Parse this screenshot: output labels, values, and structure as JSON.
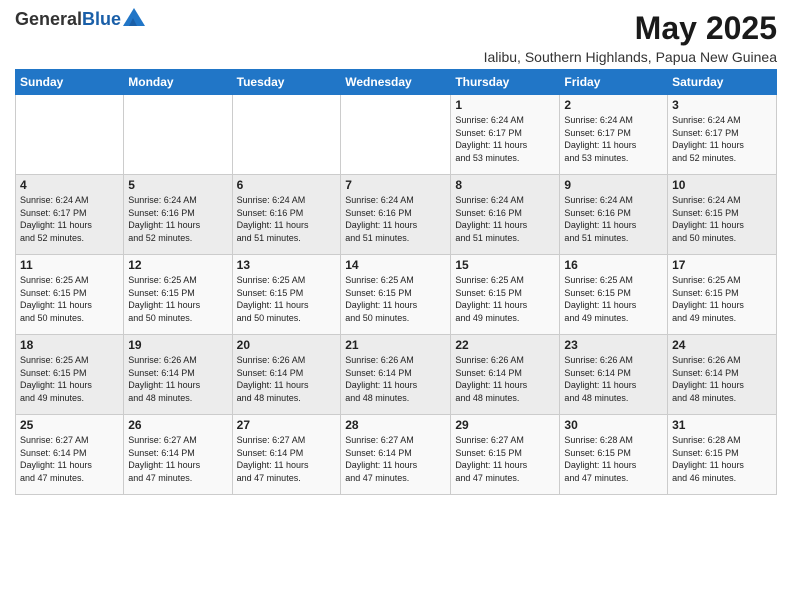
{
  "header": {
    "logo_general": "General",
    "logo_blue": "Blue",
    "month_title": "May 2025",
    "subtitle": "Ialibu, Southern Highlands, Papua New Guinea"
  },
  "days_of_week": [
    "Sunday",
    "Monday",
    "Tuesday",
    "Wednesday",
    "Thursday",
    "Friday",
    "Saturday"
  ],
  "weeks": [
    [
      {
        "day": "",
        "info": ""
      },
      {
        "day": "",
        "info": ""
      },
      {
        "day": "",
        "info": ""
      },
      {
        "day": "",
        "info": ""
      },
      {
        "day": "1",
        "info": "Sunrise: 6:24 AM\nSunset: 6:17 PM\nDaylight: 11 hours\nand 53 minutes."
      },
      {
        "day": "2",
        "info": "Sunrise: 6:24 AM\nSunset: 6:17 PM\nDaylight: 11 hours\nand 53 minutes."
      },
      {
        "day": "3",
        "info": "Sunrise: 6:24 AM\nSunset: 6:17 PM\nDaylight: 11 hours\nand 52 minutes."
      }
    ],
    [
      {
        "day": "4",
        "info": "Sunrise: 6:24 AM\nSunset: 6:17 PM\nDaylight: 11 hours\nand 52 minutes."
      },
      {
        "day": "5",
        "info": "Sunrise: 6:24 AM\nSunset: 6:16 PM\nDaylight: 11 hours\nand 52 minutes."
      },
      {
        "day": "6",
        "info": "Sunrise: 6:24 AM\nSunset: 6:16 PM\nDaylight: 11 hours\nand 51 minutes."
      },
      {
        "day": "7",
        "info": "Sunrise: 6:24 AM\nSunset: 6:16 PM\nDaylight: 11 hours\nand 51 minutes."
      },
      {
        "day": "8",
        "info": "Sunrise: 6:24 AM\nSunset: 6:16 PM\nDaylight: 11 hours\nand 51 minutes."
      },
      {
        "day": "9",
        "info": "Sunrise: 6:24 AM\nSunset: 6:16 PM\nDaylight: 11 hours\nand 51 minutes."
      },
      {
        "day": "10",
        "info": "Sunrise: 6:24 AM\nSunset: 6:15 PM\nDaylight: 11 hours\nand 50 minutes."
      }
    ],
    [
      {
        "day": "11",
        "info": "Sunrise: 6:25 AM\nSunset: 6:15 PM\nDaylight: 11 hours\nand 50 minutes."
      },
      {
        "day": "12",
        "info": "Sunrise: 6:25 AM\nSunset: 6:15 PM\nDaylight: 11 hours\nand 50 minutes."
      },
      {
        "day": "13",
        "info": "Sunrise: 6:25 AM\nSunset: 6:15 PM\nDaylight: 11 hours\nand 50 minutes."
      },
      {
        "day": "14",
        "info": "Sunrise: 6:25 AM\nSunset: 6:15 PM\nDaylight: 11 hours\nand 50 minutes."
      },
      {
        "day": "15",
        "info": "Sunrise: 6:25 AM\nSunset: 6:15 PM\nDaylight: 11 hours\nand 49 minutes."
      },
      {
        "day": "16",
        "info": "Sunrise: 6:25 AM\nSunset: 6:15 PM\nDaylight: 11 hours\nand 49 minutes."
      },
      {
        "day": "17",
        "info": "Sunrise: 6:25 AM\nSunset: 6:15 PM\nDaylight: 11 hours\nand 49 minutes."
      }
    ],
    [
      {
        "day": "18",
        "info": "Sunrise: 6:25 AM\nSunset: 6:15 PM\nDaylight: 11 hours\nand 49 minutes."
      },
      {
        "day": "19",
        "info": "Sunrise: 6:26 AM\nSunset: 6:14 PM\nDaylight: 11 hours\nand 48 minutes."
      },
      {
        "day": "20",
        "info": "Sunrise: 6:26 AM\nSunset: 6:14 PM\nDaylight: 11 hours\nand 48 minutes."
      },
      {
        "day": "21",
        "info": "Sunrise: 6:26 AM\nSunset: 6:14 PM\nDaylight: 11 hours\nand 48 minutes."
      },
      {
        "day": "22",
        "info": "Sunrise: 6:26 AM\nSunset: 6:14 PM\nDaylight: 11 hours\nand 48 minutes."
      },
      {
        "day": "23",
        "info": "Sunrise: 6:26 AM\nSunset: 6:14 PM\nDaylight: 11 hours\nand 48 minutes."
      },
      {
        "day": "24",
        "info": "Sunrise: 6:26 AM\nSunset: 6:14 PM\nDaylight: 11 hours\nand 48 minutes."
      }
    ],
    [
      {
        "day": "25",
        "info": "Sunrise: 6:27 AM\nSunset: 6:14 PM\nDaylight: 11 hours\nand 47 minutes."
      },
      {
        "day": "26",
        "info": "Sunrise: 6:27 AM\nSunset: 6:14 PM\nDaylight: 11 hours\nand 47 minutes."
      },
      {
        "day": "27",
        "info": "Sunrise: 6:27 AM\nSunset: 6:14 PM\nDaylight: 11 hours\nand 47 minutes."
      },
      {
        "day": "28",
        "info": "Sunrise: 6:27 AM\nSunset: 6:14 PM\nDaylight: 11 hours\nand 47 minutes."
      },
      {
        "day": "29",
        "info": "Sunrise: 6:27 AM\nSunset: 6:15 PM\nDaylight: 11 hours\nand 47 minutes."
      },
      {
        "day": "30",
        "info": "Sunrise: 6:28 AM\nSunset: 6:15 PM\nDaylight: 11 hours\nand 47 minutes."
      },
      {
        "day": "31",
        "info": "Sunrise: 6:28 AM\nSunset: 6:15 PM\nDaylight: 11 hours\nand 46 minutes."
      }
    ]
  ]
}
